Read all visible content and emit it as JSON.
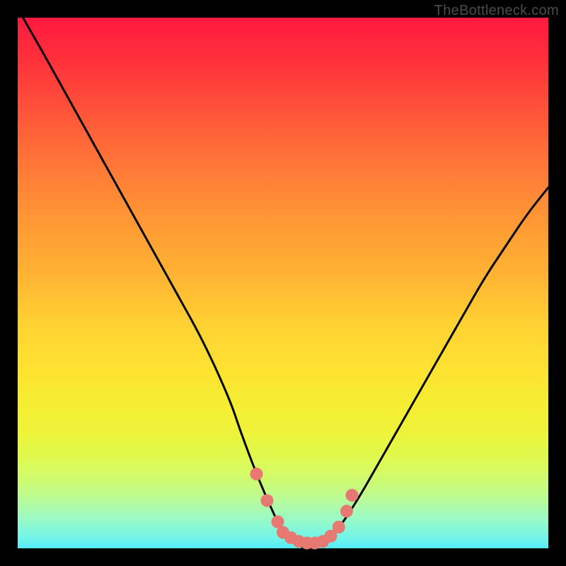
{
  "watermark": "TheBottleneck.com",
  "chart_data": {
    "type": "line",
    "title": "",
    "xlabel": "",
    "ylabel": "",
    "xlim": [
      0,
      100
    ],
    "ylim": [
      0,
      100
    ],
    "grid": false,
    "legend": false,
    "series": [
      {
        "name": "bottleneck-curve",
        "color": "#000000",
        "x": [
          1,
          5,
          10,
          15,
          20,
          25,
          30,
          35,
          40,
          42,
          45,
          48,
          50,
          52,
          54,
          56,
          58,
          60,
          64,
          68,
          72,
          76,
          80,
          84,
          88,
          92,
          96,
          100
        ],
        "y": [
          100,
          93,
          84,
          75,
          66,
          57,
          48,
          39,
          28,
          22,
          14,
          7,
          3,
          1,
          0,
          0,
          1,
          3,
          9,
          16,
          23,
          30,
          37,
          44,
          51,
          57,
          63,
          68
        ]
      },
      {
        "name": "highlight-dots",
        "color": "#e77872",
        "style": "marker",
        "x": [
          45,
          47,
          49,
          50,
          51.5,
          53,
          54.5,
          56,
          57.5,
          59,
          60.5,
          62,
          63
        ],
        "y": [
          14,
          9,
          5,
          3,
          2,
          1.3,
          1,
          1,
          1.3,
          2.3,
          4,
          7,
          10
        ]
      }
    ],
    "colors": {
      "gradient_top": "#ff1a3f",
      "gradient_mid": "#ffd232",
      "gradient_bottom": "#54ecf8",
      "curve": "#000000",
      "dots": "#e77872",
      "frame": "#000000"
    }
  }
}
